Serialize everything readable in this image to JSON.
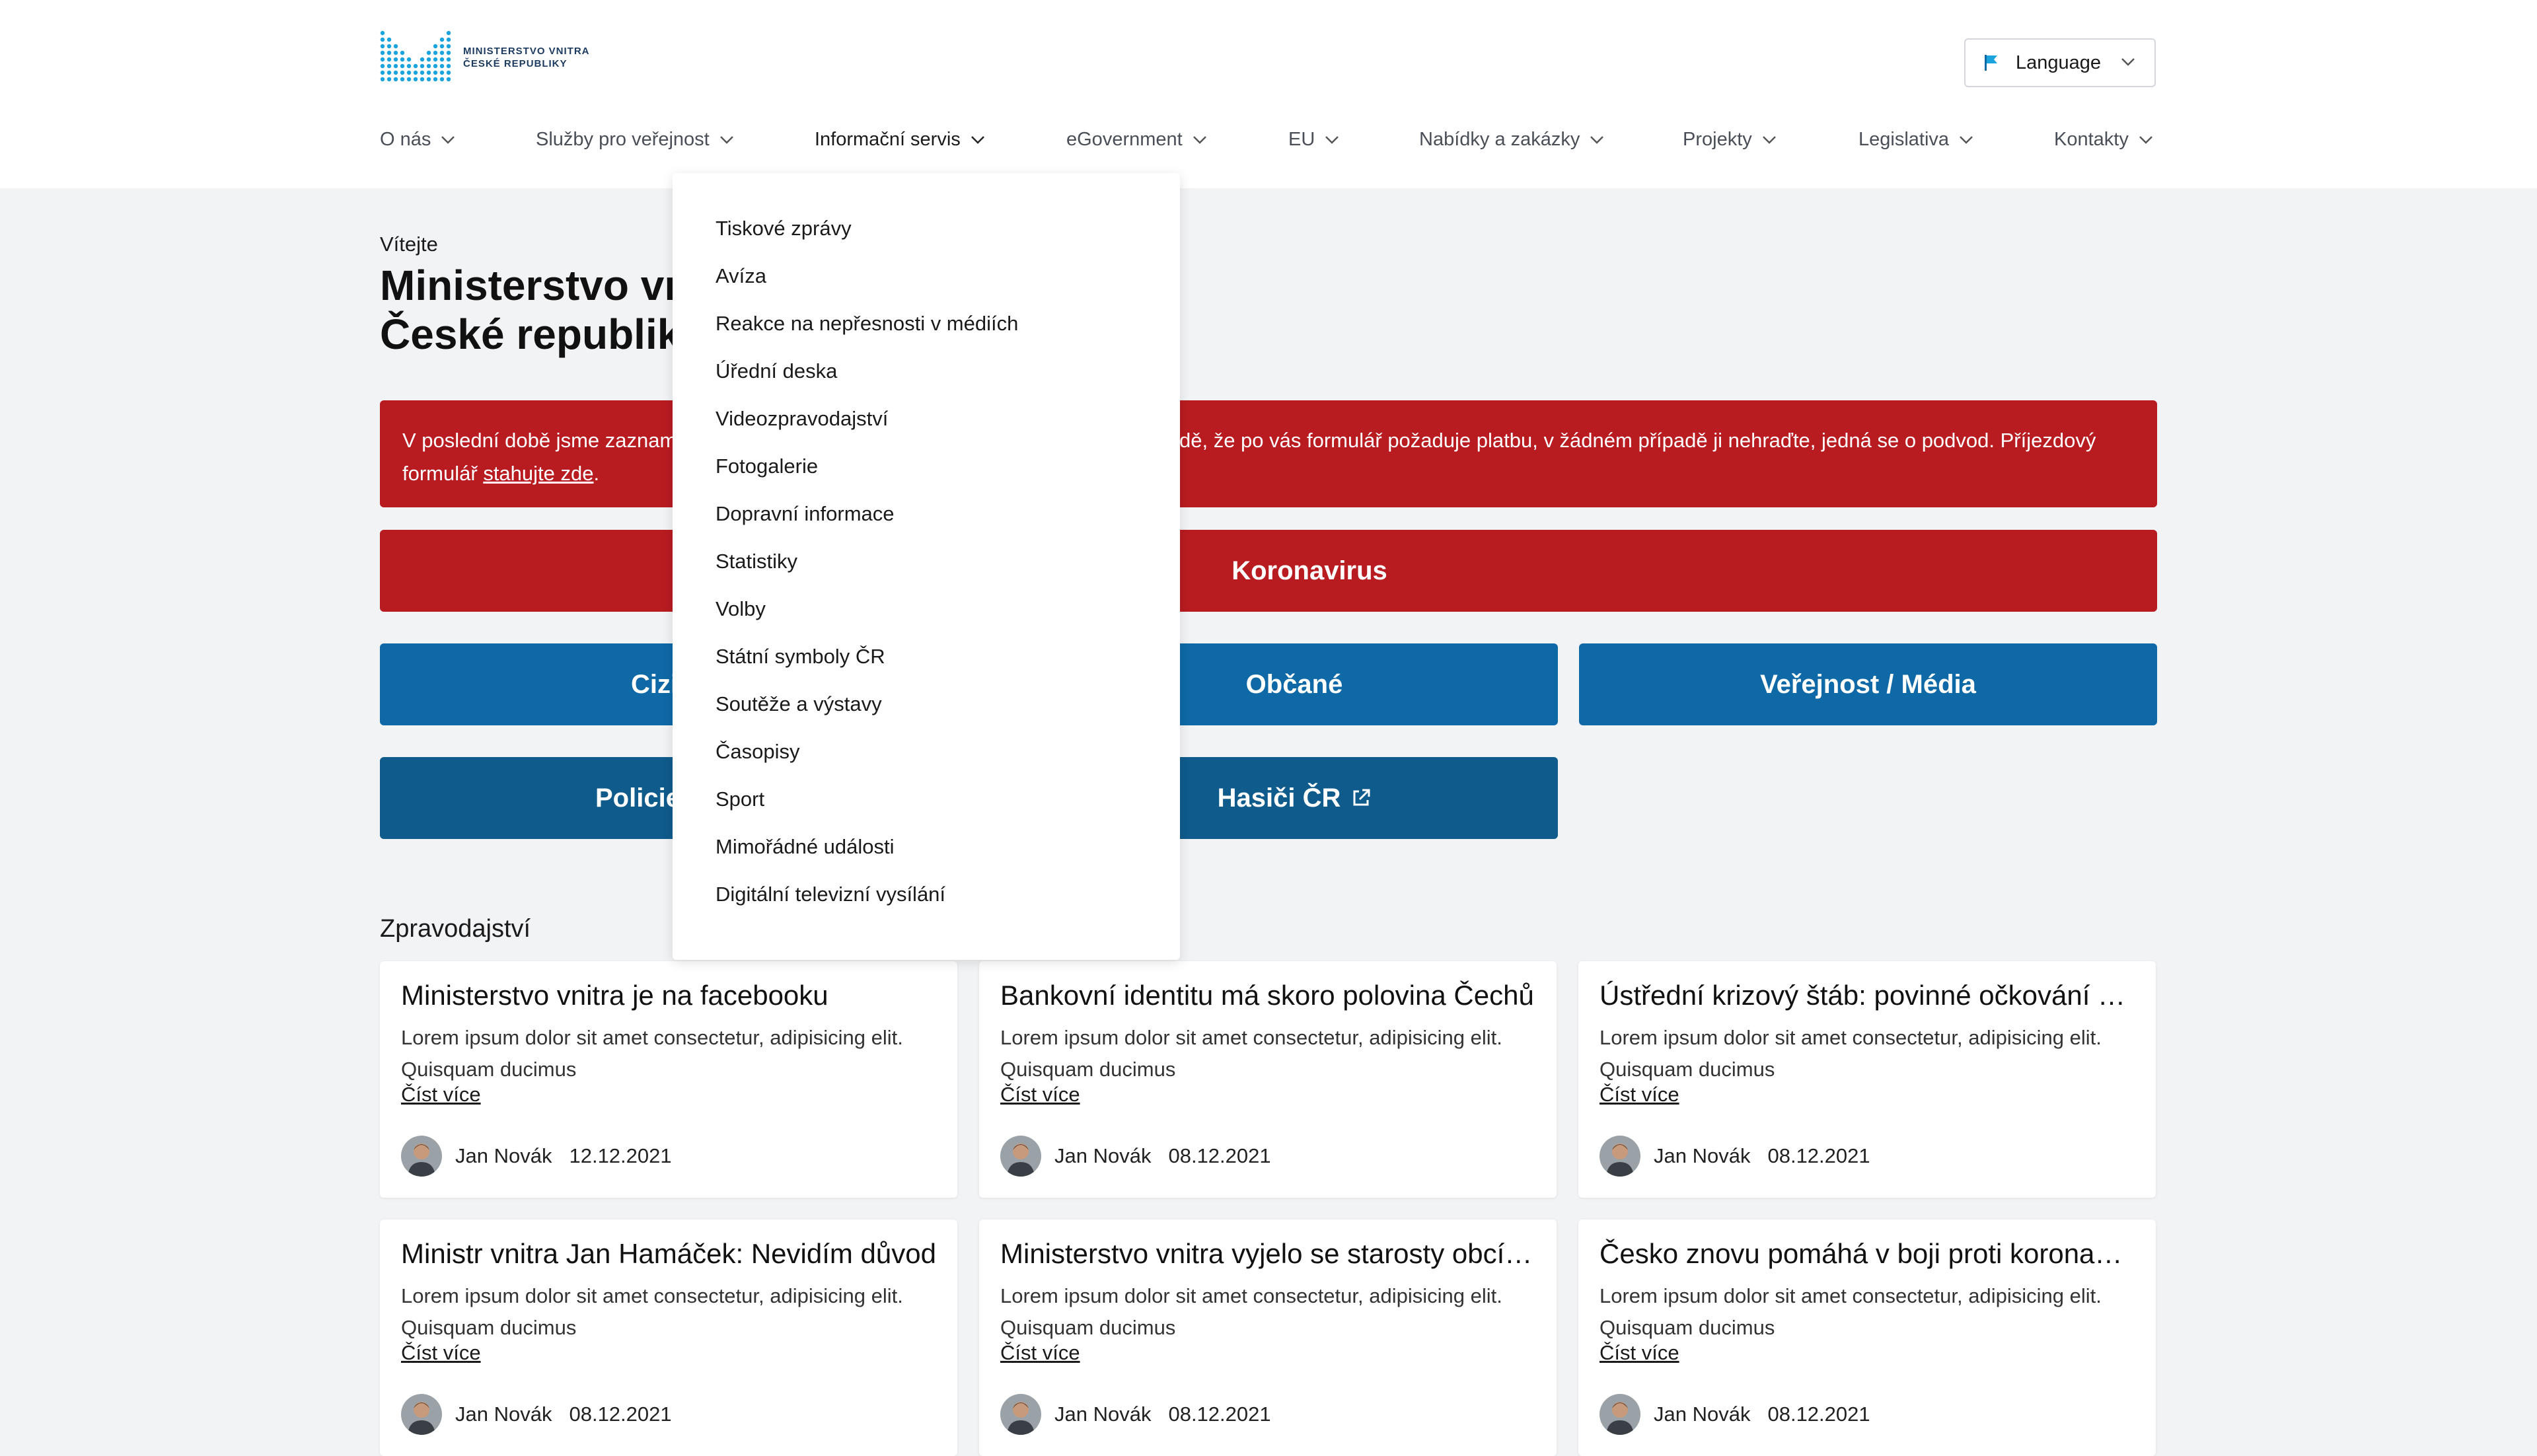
{
  "header": {
    "logo_text_line1": "MINISTERSTVO VNITRA",
    "logo_text_line2": "ČESKÉ REPUBLIKY",
    "language_label": "Language"
  },
  "nav": {
    "items": [
      {
        "label": "O nás"
      },
      {
        "label": "Služby pro veřejnost"
      },
      {
        "label": "Informační servis"
      },
      {
        "label": "eGovernment"
      },
      {
        "label": "EU"
      },
      {
        "label": "Nabídky a zakázky"
      },
      {
        "label": "Projekty"
      },
      {
        "label": "Legislativa"
      },
      {
        "label": "Kontakty"
      }
    ],
    "active": "Informační servis"
  },
  "dropdown": {
    "items": [
      {
        "label": "Tiskové zprávy"
      },
      {
        "label": "Avíza"
      },
      {
        "label": "Reakce na nepřesnosti v médiích"
      },
      {
        "label": "Úřední deska"
      },
      {
        "label": "Videozpravodajství"
      },
      {
        "label": "Fotogalerie"
      },
      {
        "label": "Dopravní informace"
      },
      {
        "label": "Statistiky"
      },
      {
        "label": "Volby"
      },
      {
        "label": "Státní symboly ČR"
      },
      {
        "label": "Soutěže a výstavy"
      },
      {
        "label": "Časopisy"
      },
      {
        "label": "Sport"
      },
      {
        "label": "Mimořádné události"
      },
      {
        "label": "Digitální televizní vysílání"
      }
    ]
  },
  "hero": {
    "welcome": "Vítejte",
    "title_line1": "Ministerstvo vn",
    "title_line2": "České republiky"
  },
  "alert": {
    "line1_start": "V poslední době jsme zaznam",
    "line1_end": "dě, že po vás formulář požaduje platbu, v žádném případě ji nehraďte, jedná se o podvod. Příjezdový",
    "line2_prefix": "formulář ",
    "link_text": "stahujte zde",
    "line2_suffix": "."
  },
  "buttons": {
    "koronavirus": "Koronavirus",
    "cizinci_partial": "Cizi",
    "obcane": "Občané",
    "verejnost_media": "Veřejnost / Média",
    "policie_partial": "Policie",
    "hasici": "Hasiči ČR"
  },
  "news": {
    "section_title": "Zpravodajství",
    "read_more": "Číst více",
    "items": [
      {
        "title": "Ministerstvo vnitra je na facebooku",
        "text": "Lorem ipsum dolor sit amet consectetur, adipisicing elit. Quisquam ducimus",
        "author": "Jan Novák",
        "date": "12.12.2021"
      },
      {
        "title": "Bankovní identitu má skoro polovina Čechů",
        "text": "Lorem ipsum dolor sit amet consectetur, adipisicing elit. Quisquam ducimus",
        "author": "Jan Novák",
        "date": "08.12.2021"
      },
      {
        "title": "Ústřední krizový štáb: povinné očkování proti",
        "text": "Lorem ipsum dolor sit amet consectetur, adipisicing elit. Quisquam ducimus",
        "author": "Jan Novák",
        "date": "08.12.2021"
      },
      {
        "title": "Ministr vnitra Jan Hamáček: Nevidím důvod",
        "text": "Lorem ipsum dolor sit amet consectetur, adipisicing elit. Quisquam ducimus",
        "author": "Jan Novák",
        "date": "08.12.2021"
      },
      {
        "title": "Ministerstvo vnitra vyjelo se starosty obcí na",
        "text": "Lorem ipsum dolor sit amet consectetur, adipisicing elit. Quisquam ducimus",
        "author": "Jan Novák",
        "date": "08.12.2021"
      },
      {
        "title": "Česko znovu pomáhá v boji proti koronaviru",
        "text": "Lorem ipsum dolor sit amet consectetur, adipisicing elit. Quisquam ducimus",
        "author": "Jan Novák",
        "date": "08.12.2021"
      }
    ]
  },
  "colors": {
    "alert_red": "#b81c21",
    "primary_blue": "#0e69a6",
    "dark_blue": "#0f5b8c",
    "logo_blue": "#1aa3dc"
  }
}
